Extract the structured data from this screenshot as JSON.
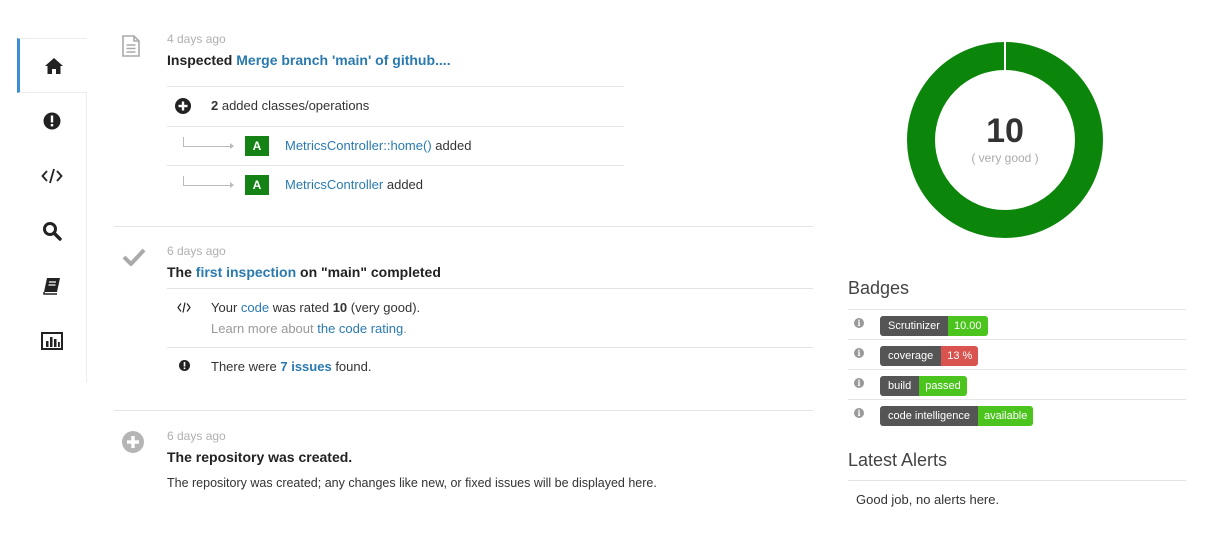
{
  "sidebar": {
    "items": [
      {
        "name": "home-icon",
        "label": "Home"
      },
      {
        "name": "issues-icon",
        "label": "Issues"
      },
      {
        "name": "code-icon",
        "label": "Code"
      },
      {
        "name": "search-icon",
        "label": "Search"
      },
      {
        "name": "book-icon",
        "label": "Docs"
      },
      {
        "name": "chart-icon",
        "label": "Statistics"
      }
    ]
  },
  "feed": {
    "entry1": {
      "time": "4 days ago",
      "prefix": "Inspected",
      "link": "Merge branch 'main' of github....",
      "summary_count": "2",
      "summary_text": " added classes/operations",
      "items": [
        {
          "badge": "A",
          "link": "MetricsController::home()",
          "suffix": " added"
        },
        {
          "badge": "A",
          "link": "MetricsController",
          "suffix": " added"
        }
      ]
    },
    "entry2": {
      "time": "6 days ago",
      "prefix": "The ",
      "link": "first inspection",
      "suffix": " on \"main\" completed",
      "rating_pre": "Your ",
      "rating_link": "code",
      "rating_mid": " was rated ",
      "rating_value": "10",
      "rating_post": " (very good).",
      "learn_pre": "Learn more about ",
      "learn_link": "the code rating",
      "learn_post": ".",
      "issues_pre": "There were ",
      "issues_link": "7 issues",
      "issues_post": " found."
    },
    "entry3": {
      "time": "6 days ago",
      "title": "The repository was created.",
      "text": "The repository was created; any changes like new, or fixed issues will be displayed here."
    }
  },
  "score": {
    "value": "10",
    "label": "( very good )",
    "fraction": 1.0,
    "color": "#0b860b"
  },
  "badges": {
    "title": "Badges",
    "items": [
      {
        "key": "Scrutinizer",
        "value": "10.00",
        "color": "#4bc51d"
      },
      {
        "key": "coverage",
        "value": "13 %",
        "color": "#d9534f"
      },
      {
        "key": "build",
        "value": "passed",
        "color": "#4bc51d"
      },
      {
        "key": "code intelligence",
        "value": "available",
        "color": "#4bc51d"
      }
    ]
  },
  "alerts": {
    "title": "Latest Alerts",
    "text": "Good job, no alerts here."
  }
}
